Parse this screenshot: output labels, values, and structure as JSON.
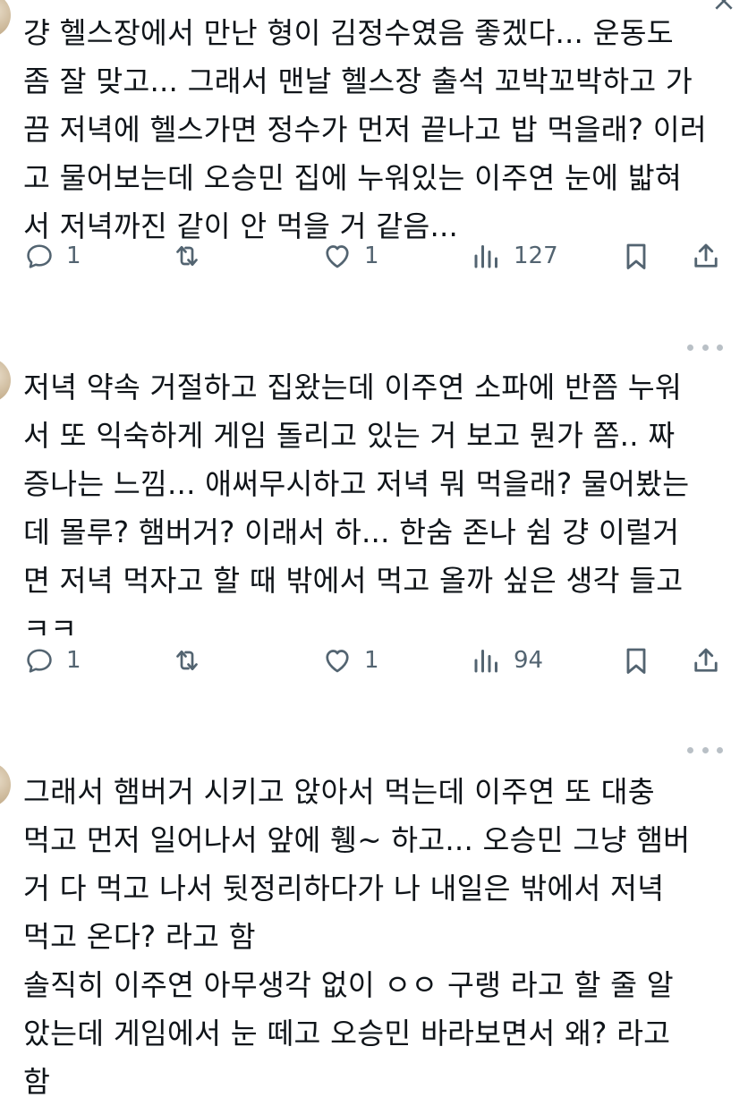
{
  "tweets": [
    {
      "text": "걍 헬스장에서 만난 형이 김정수였음 좋겠다... 운동도\n좀 잘 맞고... 그래서 맨날 헬스장 출석 꼬박꼬박하고 가\n끔 저녁에 헬스가면 정수가 먼저 끝나고 밥 먹을래? 이러\n고 물어보는데 오승민 집에 누워있는 이주연 눈에 밟혀\n서 저녁까진 같이 안 먹을 거 같음...",
      "replies": "1",
      "retweets": "",
      "likes": "1",
      "views": "127"
    },
    {
      "text": "저녁 약속 거절하고 집왔는데 이주연 소파에 반쯤 누워\n서 또 익숙하게 게임 돌리고 있는 거 보고 뭔가 쫌.. 짜\n증나는 느낌... 애써무시하고 저녁 뭐 먹을래? 물어봤는\n데 몰루? 햄버거? 이래서 하... 한숨 존나 쉼 걍 이럴거\n면 저녁 먹자고 할 때 밖에서 먹고 올까 싶은 생각 들고\nㅋㅋ",
      "replies": "1",
      "retweets": "",
      "likes": "1",
      "views": "94"
    },
    {
      "text": "그래서 햄버거 시키고 앉아서 먹는데 이주연 또 대충\n먹고 먼저 일어나서 앞에 휑~ 하고... 오승민 그냥 햄버\n거 다 먹고 나서 뒷정리하다가 나 내일은 밖에서 저녁\n먹고 온다? 라고 함\n솔직히 이주연 아무생각 없이 ㅇㅇ 구랭 라고 할 줄 알\n았는데 게임에서 눈 떼고 오승민 바라보면서 왜? 라고\n함"
    }
  ],
  "icons": {
    "reply": "speech-bubble-icon",
    "retweet": "retweet-arrows-icon",
    "like": "heart-icon",
    "views": "bar-chart-icon",
    "bookmark": "bookmark-icon",
    "share": "share-upload-icon",
    "more": "more-dots-icon"
  },
  "colors": {
    "text": "#0f1419",
    "icon": "#536471",
    "dots": "#b9c0c6"
  }
}
